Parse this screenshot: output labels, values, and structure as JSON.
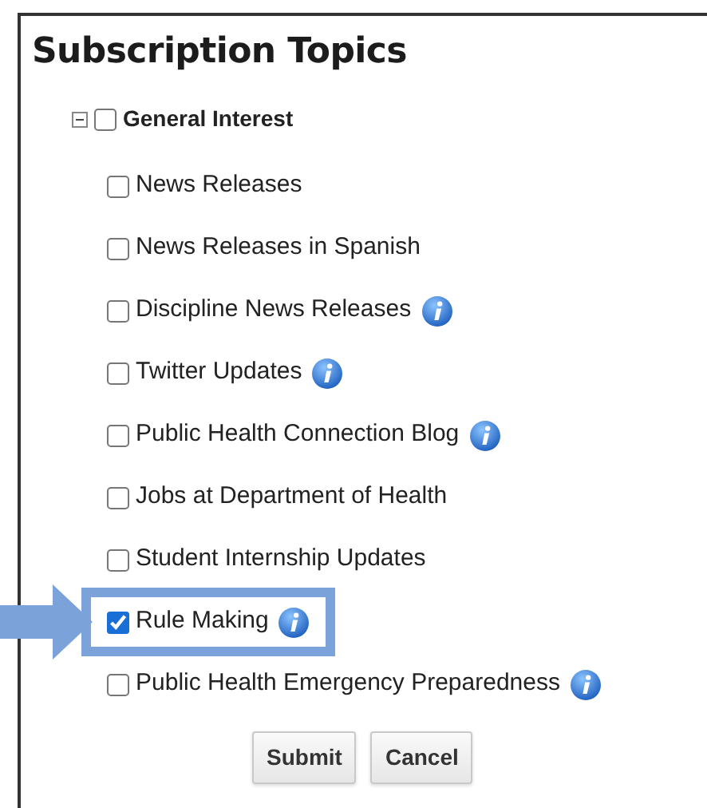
{
  "title": "Subscription Topics",
  "group": {
    "label": "General Interest",
    "expanded": true,
    "checked": false,
    "children": [
      {
        "label": "News Releases",
        "checked": false,
        "info": false,
        "highlighted": false
      },
      {
        "label": "News Releases in Spanish",
        "checked": false,
        "info": false,
        "highlighted": false
      },
      {
        "label": "Discipline News Releases",
        "checked": false,
        "info": true,
        "highlighted": false
      },
      {
        "label": "Twitter Updates",
        "checked": false,
        "info": true,
        "highlighted": false
      },
      {
        "label": "Public Health Connection Blog",
        "checked": false,
        "info": true,
        "highlighted": false
      },
      {
        "label": "Jobs at Department of Health",
        "checked": false,
        "info": false,
        "highlighted": false
      },
      {
        "label": "Student Internship Updates",
        "checked": false,
        "info": false,
        "highlighted": false
      },
      {
        "label": "Rule Making",
        "checked": true,
        "info": true,
        "highlighted": true
      },
      {
        "label": "Public Health Emergency Preparedness",
        "checked": false,
        "info": true,
        "highlighted": false
      }
    ]
  },
  "buttons": [
    "Submit",
    "Cancel"
  ]
}
